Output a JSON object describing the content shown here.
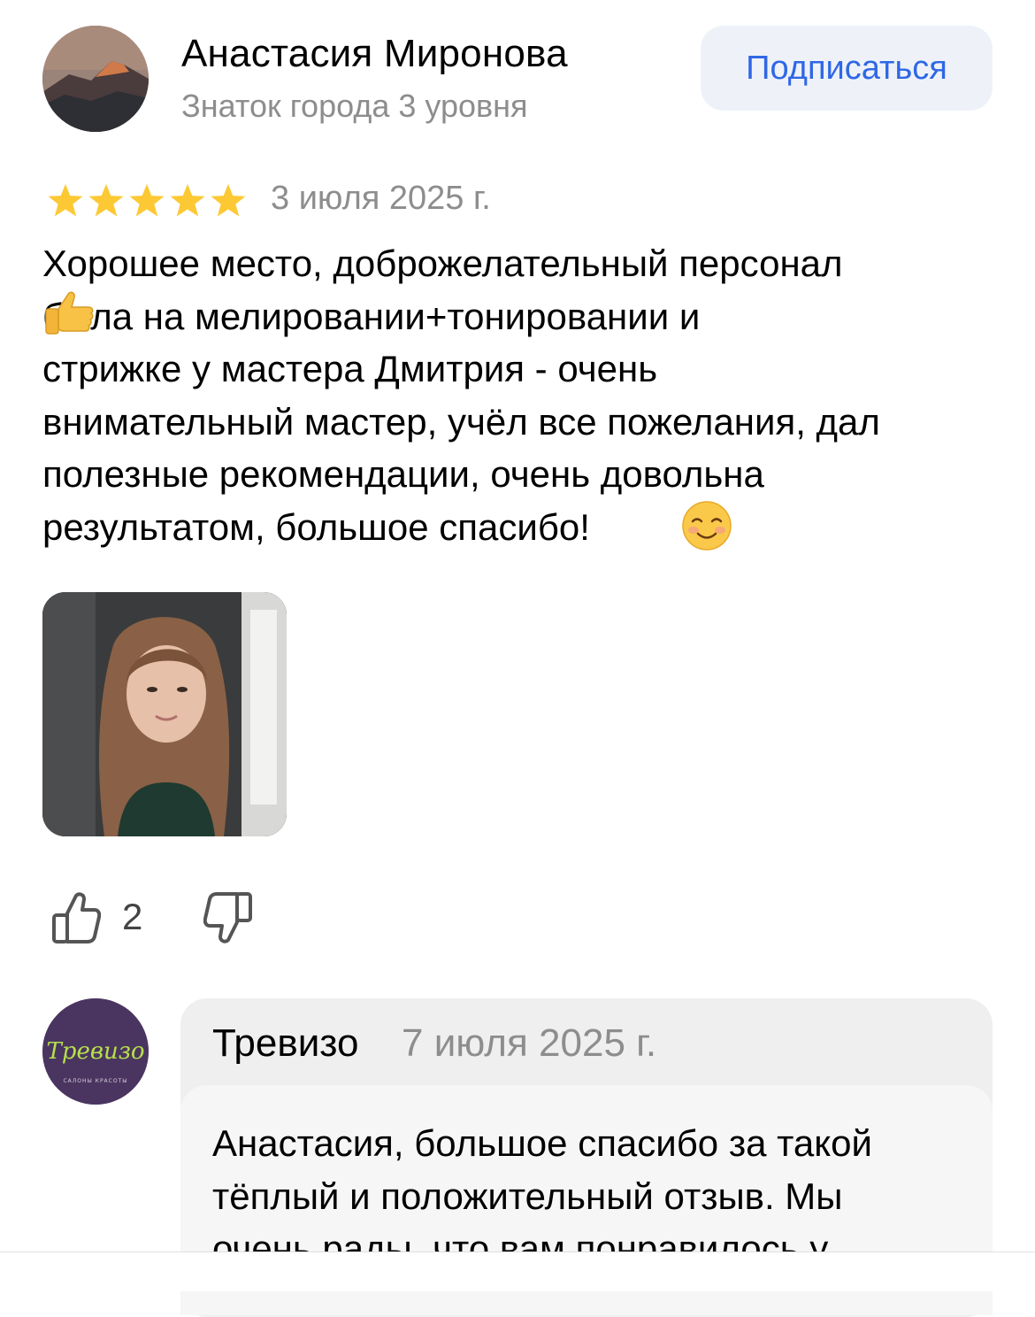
{
  "author": {
    "name": "Анастасия Миронова",
    "level": "Знаток города 3 уровня",
    "subscribe_label": "Подписаться"
  },
  "review": {
    "rating": 5,
    "rating_max": 5,
    "date": "3 июля 2025 г.",
    "text": "Хорошее место, доброжелательный персонал\n      была на мелировании+тонировании и\nстрижке у мастера Дмитрия - очень\nвнимательный мастер, учёл все пожелания, дал\nполезные рекомендации, очень довольна\nрезультатом, большое спасибо!",
    "likes": "2"
  },
  "reply": {
    "company_name": "Тревизо",
    "date": "7 июля 2025 г.",
    "logo_text": "Тревизо",
    "logo_subtext": "САЛОНЫ КРАСОТЫ",
    "text": "Анастасия, большое спасибо за такой\nтёплый и положительный отзыв. Мы\nочень рады, что вам понравилось у"
  },
  "colors": {
    "accent": "#2f67e6",
    "star": "#fcc934",
    "muted": "#8d8d8d",
    "logo_bg": "#4a3560",
    "logo_text": "#b6e04a"
  },
  "icons": [
    "star-icon",
    "thumb-up-emoji",
    "smiling-emoji",
    "like-icon",
    "dislike-icon"
  ]
}
